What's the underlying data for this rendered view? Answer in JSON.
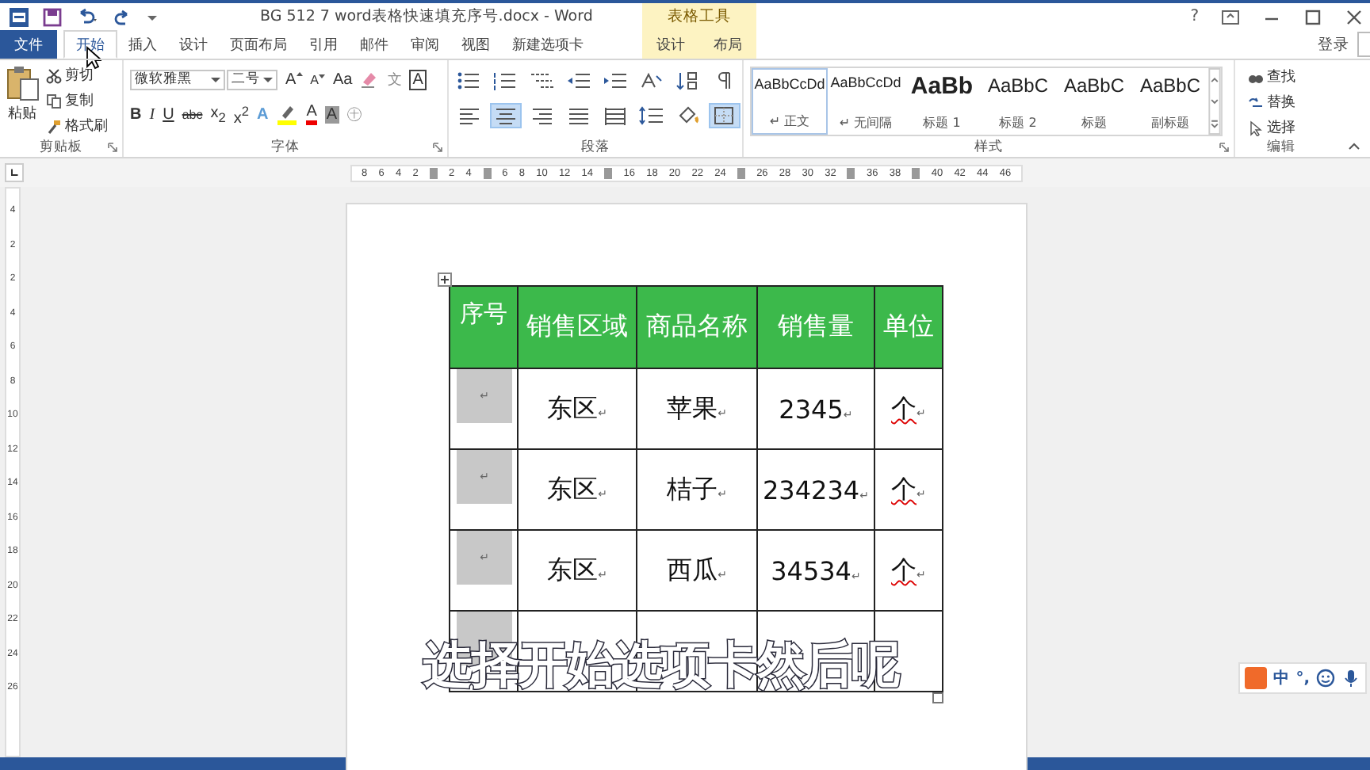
{
  "window": {
    "title": "BG 512 7 word表格快速填充序号.docx - Word",
    "context_group": "表格工具",
    "help": "?",
    "sign_in": "登录"
  },
  "tabs": [
    {
      "label": "文件",
      "kind": "file",
      "selected": false
    },
    {
      "label": "开始",
      "kind": "normal",
      "selected": true
    },
    {
      "label": "插入",
      "kind": "normal",
      "selected": false
    },
    {
      "label": "设计",
      "kind": "normal",
      "selected": false
    },
    {
      "label": "页面布局",
      "kind": "normal",
      "selected": false
    },
    {
      "label": "引用",
      "kind": "normal",
      "selected": false
    },
    {
      "label": "邮件",
      "kind": "normal",
      "selected": false
    },
    {
      "label": "审阅",
      "kind": "normal",
      "selected": false
    },
    {
      "label": "视图",
      "kind": "normal",
      "selected": false
    },
    {
      "label": "新建选项卡",
      "kind": "normal",
      "selected": false
    },
    {
      "label": "设计",
      "kind": "context",
      "selected": false
    },
    {
      "label": "布局",
      "kind": "context",
      "selected": false
    }
  ],
  "ribbon": {
    "clipboard": {
      "label": "剪贴板",
      "paste": "粘贴",
      "cut": "剪切",
      "copy": "复制",
      "format_painter": "格式刷"
    },
    "font": {
      "label": "字体",
      "name": "微软雅黑",
      "size": "二号",
      "grow": "A",
      "shrink": "A",
      "case": "Aa",
      "phonetic": "文",
      "border_char": "A",
      "bold": "B",
      "italic": "I",
      "underline": "U",
      "strike": "abc",
      "subscript": "x$_{2}$",
      "superscript": "x$^{2}$",
      "effects": "A",
      "font_color": "A",
      "shade": "A",
      "enclose": "㊉"
    },
    "paragraph": {
      "label": "段落",
      "alignments": [
        {
          "selected": false
        },
        {
          "selected": true
        },
        {
          "selected": false
        },
        {
          "selected": false
        },
        {
          "selected": false
        }
      ],
      "borders_selected": true
    },
    "styles": {
      "label": "样式",
      "items": [
        {
          "preview": "AaBbCcDd",
          "label": "↵ 正文",
          "kind": "normal",
          "selected": true
        },
        {
          "preview": "AaBbCcDd",
          "label": "↵ 无间隔",
          "kind": "normal",
          "selected": false
        },
        {
          "preview": "AaBb",
          "label": "标题 1",
          "kind": "heading1",
          "selected": false
        },
        {
          "preview": "AaBbC",
          "label": "标题 2",
          "kind": "heading",
          "selected": false
        },
        {
          "preview": "AaBbC",
          "label": "标题",
          "kind": "heading",
          "selected": false
        },
        {
          "preview": "AaBbC",
          "label": "副标题",
          "kind": "heading",
          "selected": false
        }
      ]
    },
    "editing": {
      "label": "编辑",
      "find": "查找",
      "replace": "替换",
      "select": "选择"
    }
  },
  "ruler": [
    {
      "kind": "number",
      "label": "8"
    },
    {
      "kind": "number",
      "label": "6"
    },
    {
      "kind": "number",
      "label": "4"
    },
    {
      "kind": "number",
      "label": "2"
    },
    {
      "kind": "marker"
    },
    {
      "kind": "number",
      "label": "2"
    },
    {
      "kind": "number",
      "label": "4"
    },
    {
      "kind": "marker"
    },
    {
      "kind": "number",
      "label": "6"
    },
    {
      "kind": "number",
      "label": "8"
    },
    {
      "kind": "number",
      "label": "10"
    },
    {
      "kind": "number",
      "label": "12"
    },
    {
      "kind": "number",
      "label": "14"
    },
    {
      "kind": "marker"
    },
    {
      "kind": "number",
      "label": "16"
    },
    {
      "kind": "number",
      "label": "18"
    },
    {
      "kind": "number",
      "label": "20"
    },
    {
      "kind": "number",
      "label": "22"
    },
    {
      "kind": "number",
      "label": "24"
    },
    {
      "kind": "marker"
    },
    {
      "kind": "number",
      "label": "26"
    },
    {
      "kind": "number",
      "label": "28"
    },
    {
      "kind": "number",
      "label": "30"
    },
    {
      "kind": "number",
      "label": "32"
    },
    {
      "kind": "marker"
    },
    {
      "kind": "number",
      "label": "36"
    },
    {
      "kind": "number",
      "label": "38"
    },
    {
      "kind": "marker"
    },
    {
      "kind": "number",
      "label": "40"
    },
    {
      "kind": "number",
      "label": "42"
    },
    {
      "kind": "number",
      "label": "44"
    },
    {
      "kind": "number",
      "label": "46"
    }
  ],
  "vertical_ruler": [
    "4",
    "2",
    "2",
    "4",
    "6",
    "8",
    "10",
    "12",
    "14",
    "16",
    "18",
    "20",
    "22",
    "24",
    "26"
  ],
  "table": {
    "columns": [
      "序号",
      "销售区域",
      "商品名称",
      "销售量",
      "单位"
    ],
    "rows": [
      {
        "cells": [
          {
            "shaded": true,
            "mark": "↵"
          },
          {
            "shaded": false,
            "text": "东区",
            "mark": "↵",
            "misspelled": false
          },
          {
            "shaded": false,
            "text": "苹果",
            "mark": "↵",
            "misspelled": false
          },
          {
            "shaded": false,
            "text": "2345",
            "mark": "↵",
            "misspelled": false
          },
          {
            "shaded": false,
            "text": "个",
            "mark": "↵",
            "misspelled": true
          }
        ]
      },
      {
        "cells": [
          {
            "shaded": true,
            "mark": "↵"
          },
          {
            "shaded": false,
            "text": "东区",
            "mark": "↵",
            "misspelled": false
          },
          {
            "shaded": false,
            "text": "桔子",
            "mark": "↵",
            "misspelled": false
          },
          {
            "shaded": false,
            "text": "234234",
            "mark": "↵",
            "misspelled": false
          },
          {
            "shaded": false,
            "text": "个",
            "mark": "↵",
            "misspelled": true
          }
        ]
      },
      {
        "cells": [
          {
            "shaded": true,
            "mark": "↵"
          },
          {
            "shaded": false,
            "text": "东区",
            "mark": "↵",
            "misspelled": false
          },
          {
            "shaded": false,
            "text": "西瓜",
            "mark": "↵",
            "misspelled": false
          },
          {
            "shaded": false,
            "text": "34534",
            "mark": "↵",
            "misspelled": false
          },
          {
            "shaded": false,
            "text": "个",
            "mark": "↵",
            "misspelled": true
          }
        ]
      },
      {
        "cells": [
          {
            "shaded": true
          },
          {
            "shaded": false
          },
          {
            "shaded": false
          },
          {
            "shaded": false
          },
          {
            "shaded": false
          }
        ]
      }
    ]
  },
  "subtitle": "选择开始选项卡然后呢",
  "ime": {
    "mode": "中",
    "punct": "°,"
  }
}
